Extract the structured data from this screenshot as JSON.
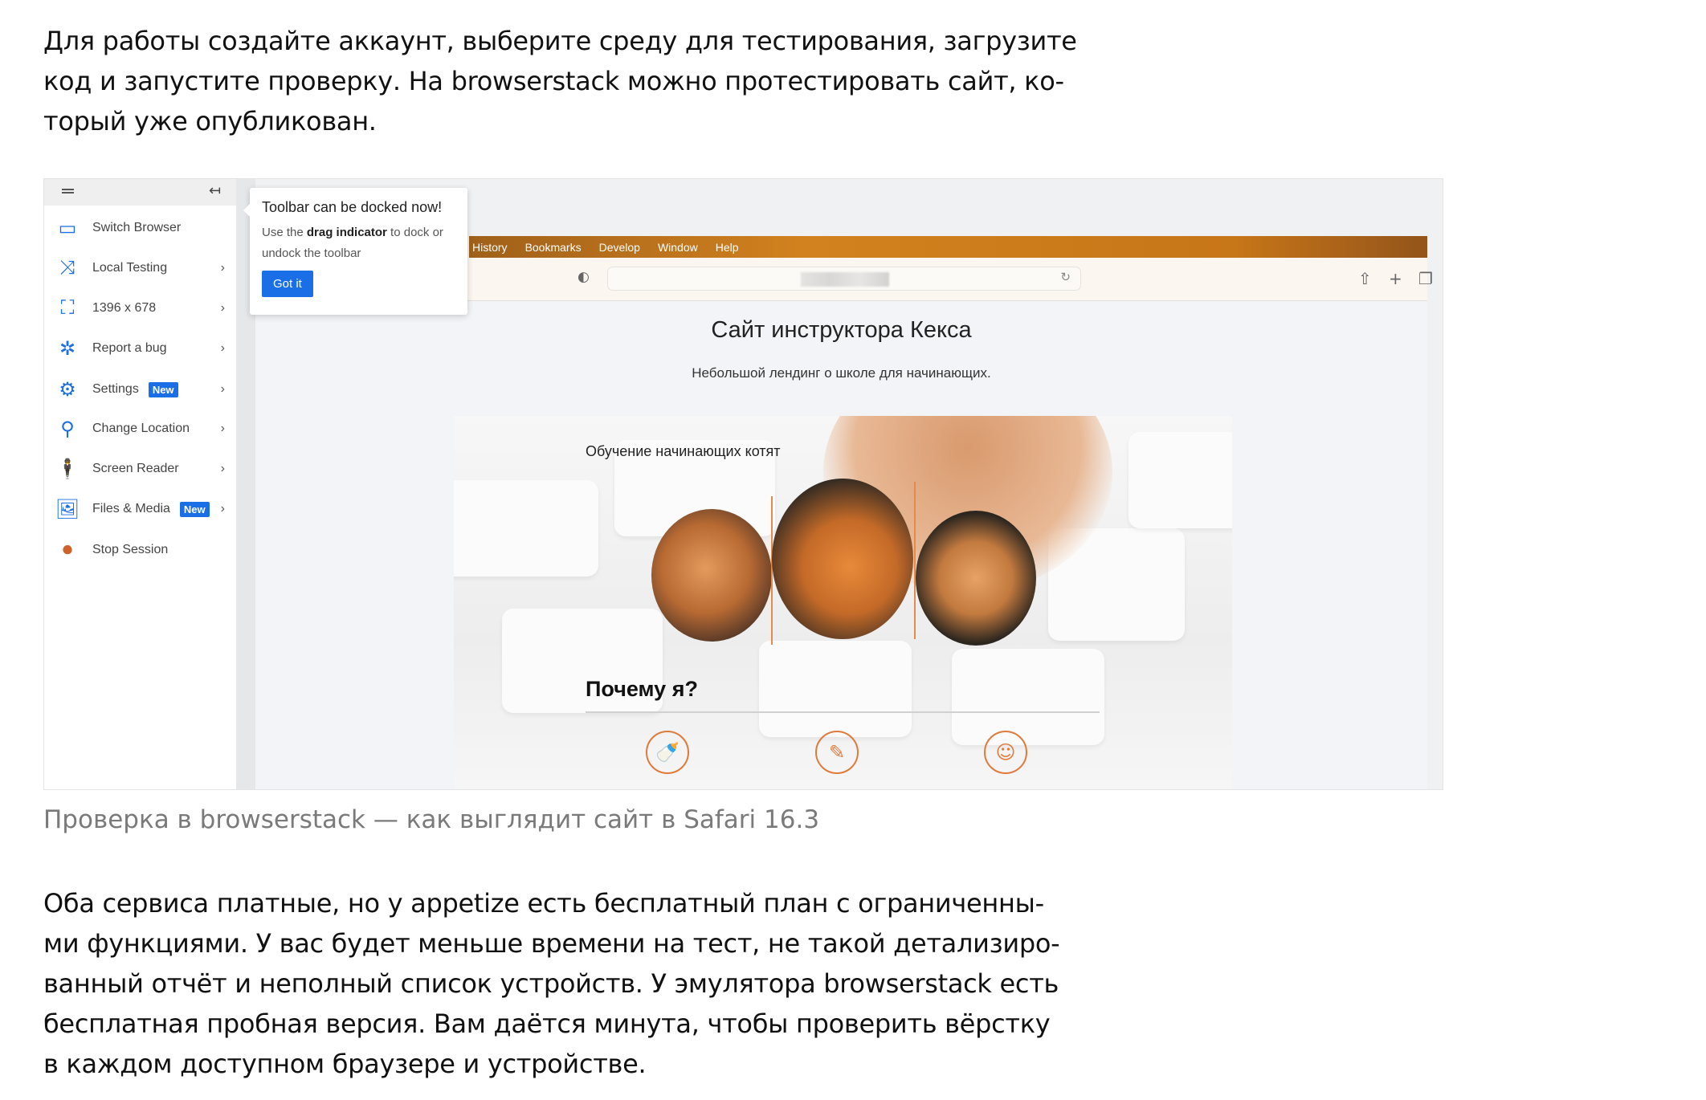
{
  "intro_paragraph": [
    "Для работы создайте аккаунт, выберите среду для тестирования, загрузите",
    "код и запустите проверку. На browserstack можно протестировать сайт, ко-",
    "торый уже опубликован."
  ],
  "screenshot": {
    "sidebar": {
      "items": [
        {
          "label": "Switch Browser",
          "icon": "devices-icon",
          "chevron": false
        },
        {
          "label": "Local Testing",
          "icon": "shuffle-icon",
          "chevron": true
        },
        {
          "label": "1396 x 678",
          "icon": "resolution-icon",
          "chevron": true
        },
        {
          "label": "Report a bug",
          "icon": "bug-icon",
          "chevron": true
        },
        {
          "label": "Settings",
          "icon": "gear-icon",
          "chevron": true,
          "badge": "New"
        },
        {
          "label": "Change Location",
          "icon": "location-pin-icon",
          "chevron": true
        },
        {
          "label": "Screen Reader",
          "icon": "accessibility-icon",
          "chevron": true
        },
        {
          "label": "Files & Media",
          "icon": "image-icon",
          "chevron": true,
          "badge": "New"
        },
        {
          "label": "Stop Session",
          "icon": "stop-icon",
          "chevron": false
        }
      ]
    },
    "tooltip": {
      "title": "Toolbar can be docked now!",
      "text_before": "Use the ",
      "text_bold": "drag indicator",
      "text_after": " to dock or undock the toolbar",
      "button": "Got it"
    },
    "browser": {
      "menu": [
        "History",
        "Bookmarks",
        "Develop",
        "Window",
        "Help"
      ],
      "site": {
        "title": "Сайт инструктора Кекса",
        "subtitle": "Небольшой лендинг о школе для начинающих.",
        "hero_label": "Обучение начинающих котят",
        "why_heading": "Почему я?"
      }
    },
    "colors": {
      "accent_blue": "#1a6ee6",
      "site_orange": "#e07a3a",
      "menubar_orange": "#d2821e"
    }
  },
  "caption": "Проверка в browserstack — как выглядит сайт в Safari 16.3",
  "outro_paragraph": [
    "Оба сервиса платные, но у appetize есть бесплатный план с ограниченны-",
    "ми функциями. У вас будет меньше времени на тест, не такой детализиро-",
    "ванный отчёт и неполный список устройств. У эмулятора browserstack есть",
    "бесплатная пробная версия. Вам даётся минута, чтобы проверить вёрстку",
    "в каждом доступном браузере и устройстве."
  ]
}
